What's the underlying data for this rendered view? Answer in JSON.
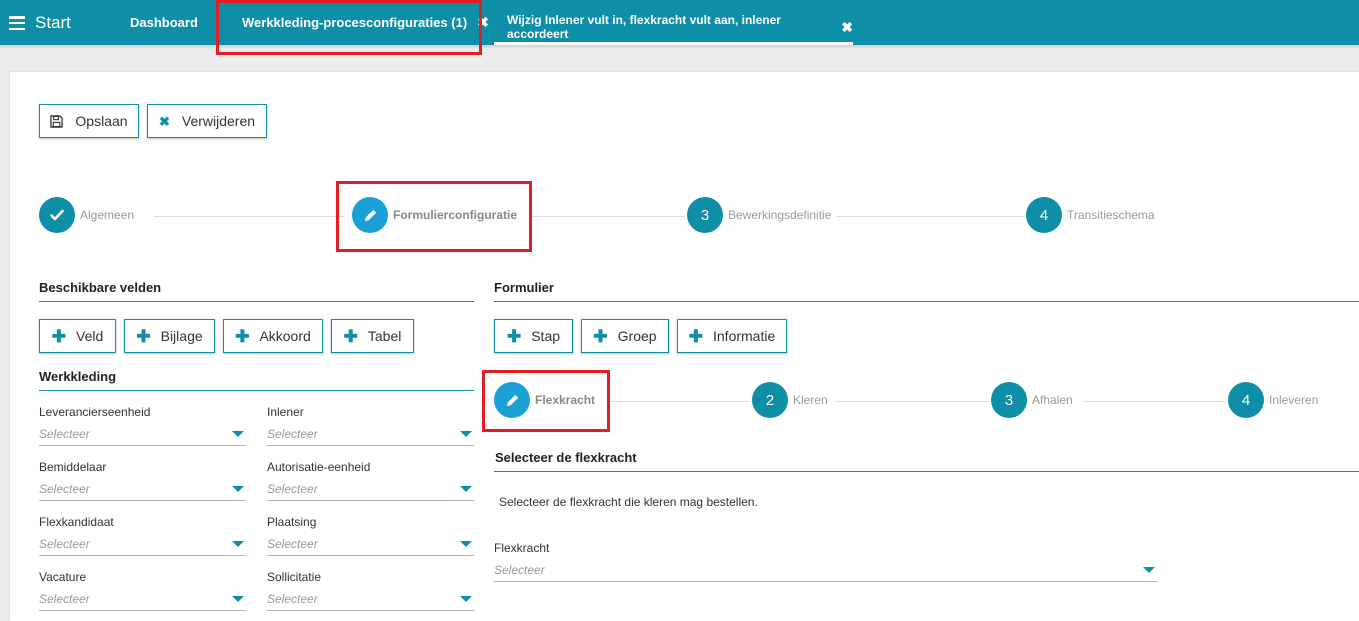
{
  "topbar": {
    "start_label": "Start",
    "tabs": [
      {
        "label": "Dashboard"
      },
      {
        "label": "Werkkleding-procesconfiguraties (1)",
        "close": "✖"
      },
      {
        "label": "Wijzig Inlener vult in, flexkracht vult aan, inlener accordeert",
        "close": "✖"
      }
    ]
  },
  "toolbar": {
    "save_label": "Opslaan",
    "delete_label": "Verwijderen"
  },
  "main_steps": [
    {
      "label": "Algemeen",
      "state": "done",
      "icon": "check-icon"
    },
    {
      "label": "Formulierconfiguratie",
      "state": "active",
      "icon": "pencil-icon"
    },
    {
      "label": "Bewerkingsdefinitie",
      "number": "3"
    },
    {
      "label": "Transitieschema",
      "number": "4"
    }
  ],
  "available_fields": {
    "title": "Beschikbare velden",
    "buttons": [
      "Veld",
      "Bijlage",
      "Akkoord",
      "Tabel"
    ],
    "group_title": "Werkkleding",
    "fields": [
      {
        "label": "Leverancierseenheid",
        "placeholder": "Selecteer"
      },
      {
        "label": "Inlener",
        "placeholder": "Selecteer"
      },
      {
        "label": "Bemiddelaar",
        "placeholder": "Selecteer"
      },
      {
        "label": "Autorisatie-eenheid",
        "placeholder": "Selecteer"
      },
      {
        "label": "Flexkandidaat",
        "placeholder": "Selecteer"
      },
      {
        "label": "Plaatsing",
        "placeholder": "Selecteer"
      },
      {
        "label": "Vacature",
        "placeholder": "Selecteer"
      },
      {
        "label": "Sollicitatie",
        "placeholder": "Selecteer"
      }
    ]
  },
  "form": {
    "title": "Formulier",
    "buttons": [
      "Stap",
      "Groep",
      "Informatie"
    ],
    "steps": [
      {
        "label": "Flexkracht",
        "state": "active",
        "icon": "pencil-icon"
      },
      {
        "label": "Kleren",
        "number": "2"
      },
      {
        "label": "Afhalen",
        "number": "3"
      },
      {
        "label": "Inleveren",
        "number": "4"
      }
    ],
    "section_title": "Selecteer de flexkracht",
    "description": "Selecteer de flexkracht die kleren mag bestellen.",
    "field": {
      "label": "Flexkracht",
      "placeholder": "Selecteer"
    }
  },
  "colors": {
    "accent": "#0e8ea7",
    "active_step": "#1ba0d6",
    "highlight": "#e01f26"
  }
}
